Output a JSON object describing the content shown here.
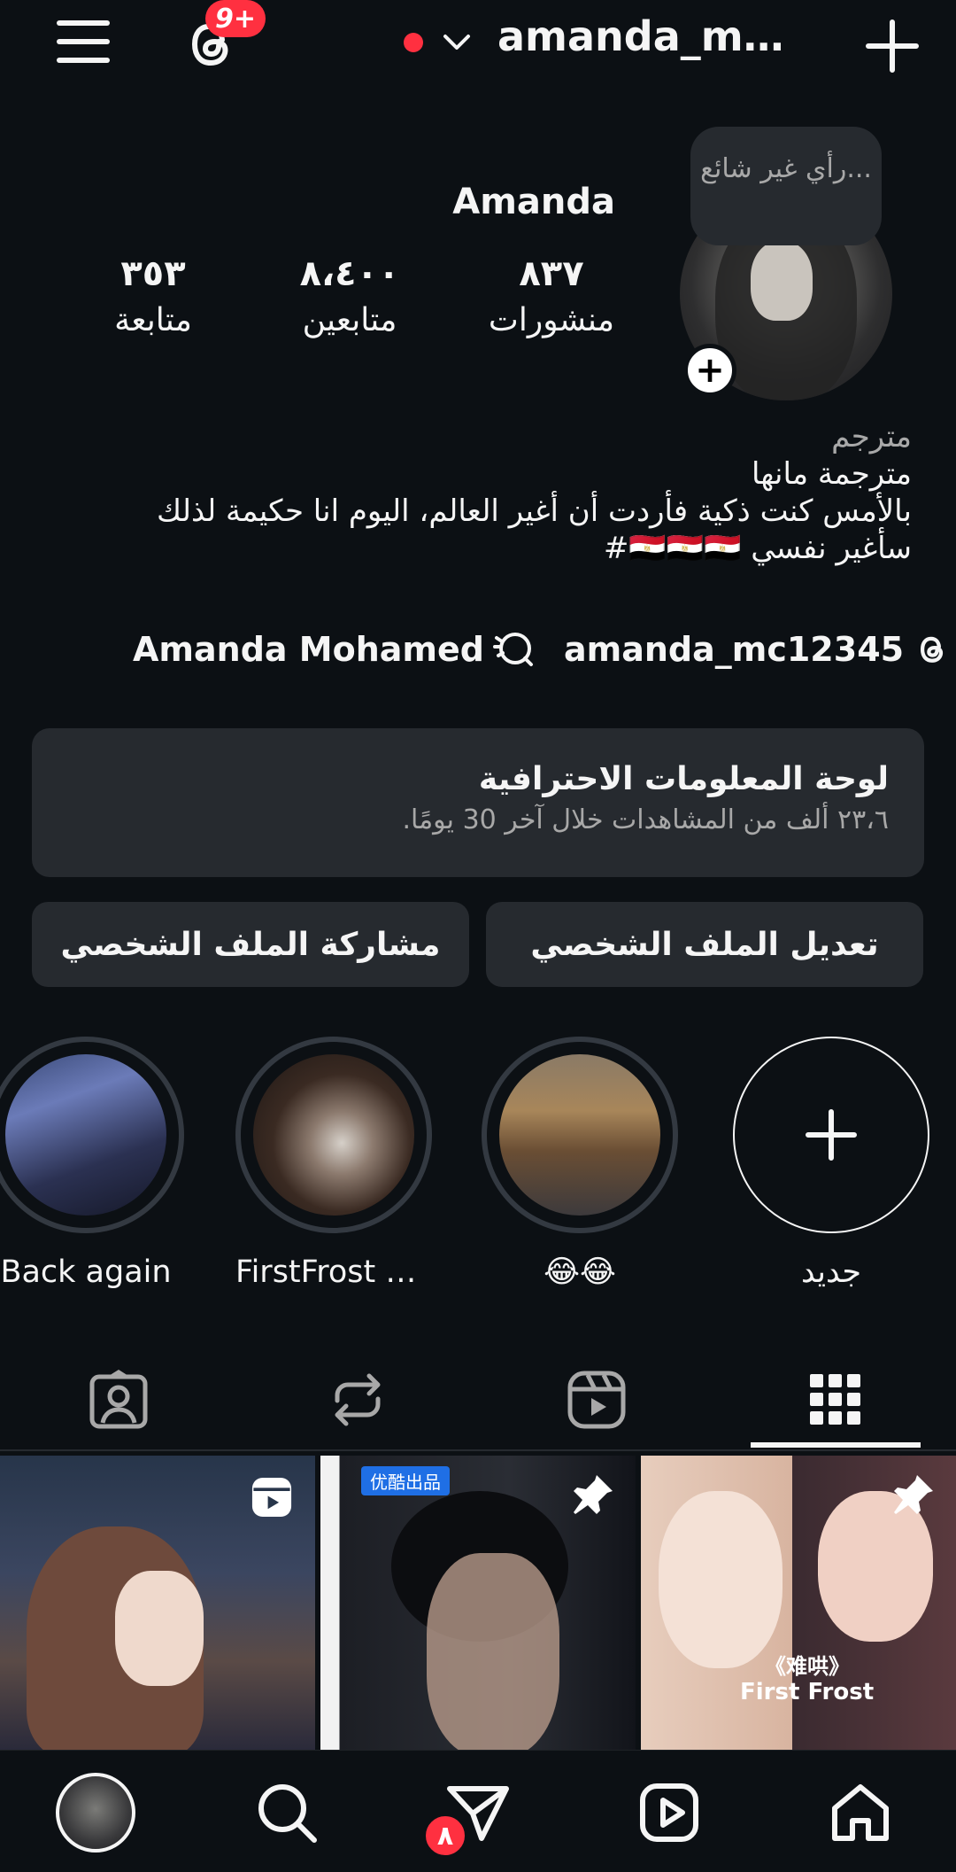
{
  "top_bar": {
    "username": "amanda_mc...",
    "notifications_badge": "9+"
  },
  "profile": {
    "display_name": "Amanda",
    "note": "رأي غير شائع...",
    "stats": [
      {
        "value": "٨٣٧",
        "label": "منشورات"
      },
      {
        "value": "٨،٤٠٠",
        "label": "متابعين"
      },
      {
        "value": "٣٥٣",
        "label": "متابعة"
      }
    ],
    "bio": {
      "category": "مترجم",
      "line1": "مترجمة مانها",
      "line2": "بالأمس كنت ذكية فأردت أن أغير العالم، اليوم انا حكيمة لذلك",
      "line3": "سأغير نفسي 🇪🇬🇪🇬🇪🇬#"
    },
    "links": {
      "threads_handle": "amanda_mc12345",
      "linked_name": "Amanda Mohamed"
    }
  },
  "dashboard": {
    "title": "لوحة المعلومات الاحترافية",
    "subtitle": "٢٣،٦ ألف من المشاهدات خلال آخر 30 يومًا."
  },
  "buttons": {
    "edit_profile": "تعديل الملف الشخصي",
    "share_profile": "مشاركة الملف الشخصي"
  },
  "highlights": [
    {
      "label": "جديد"
    },
    {
      "label": "😂😂"
    },
    {
      "label": "FirstFrost Dra..."
    },
    {
      "label": "Back again"
    }
  ],
  "grid_posts": [
    {
      "overlay_text": ""
    },
    {
      "overlay_text": "优酷出品"
    },
    {
      "overlay_text": "First Frost",
      "overlay_text2": "《难哄》"
    }
  ],
  "bottom_nav": {
    "messages_badge": "٨"
  },
  "colors": {
    "background": "#0c1014",
    "surface": "#262a2f",
    "badge_red": "#ff3040",
    "muted_text": "#a8a8a8"
  }
}
